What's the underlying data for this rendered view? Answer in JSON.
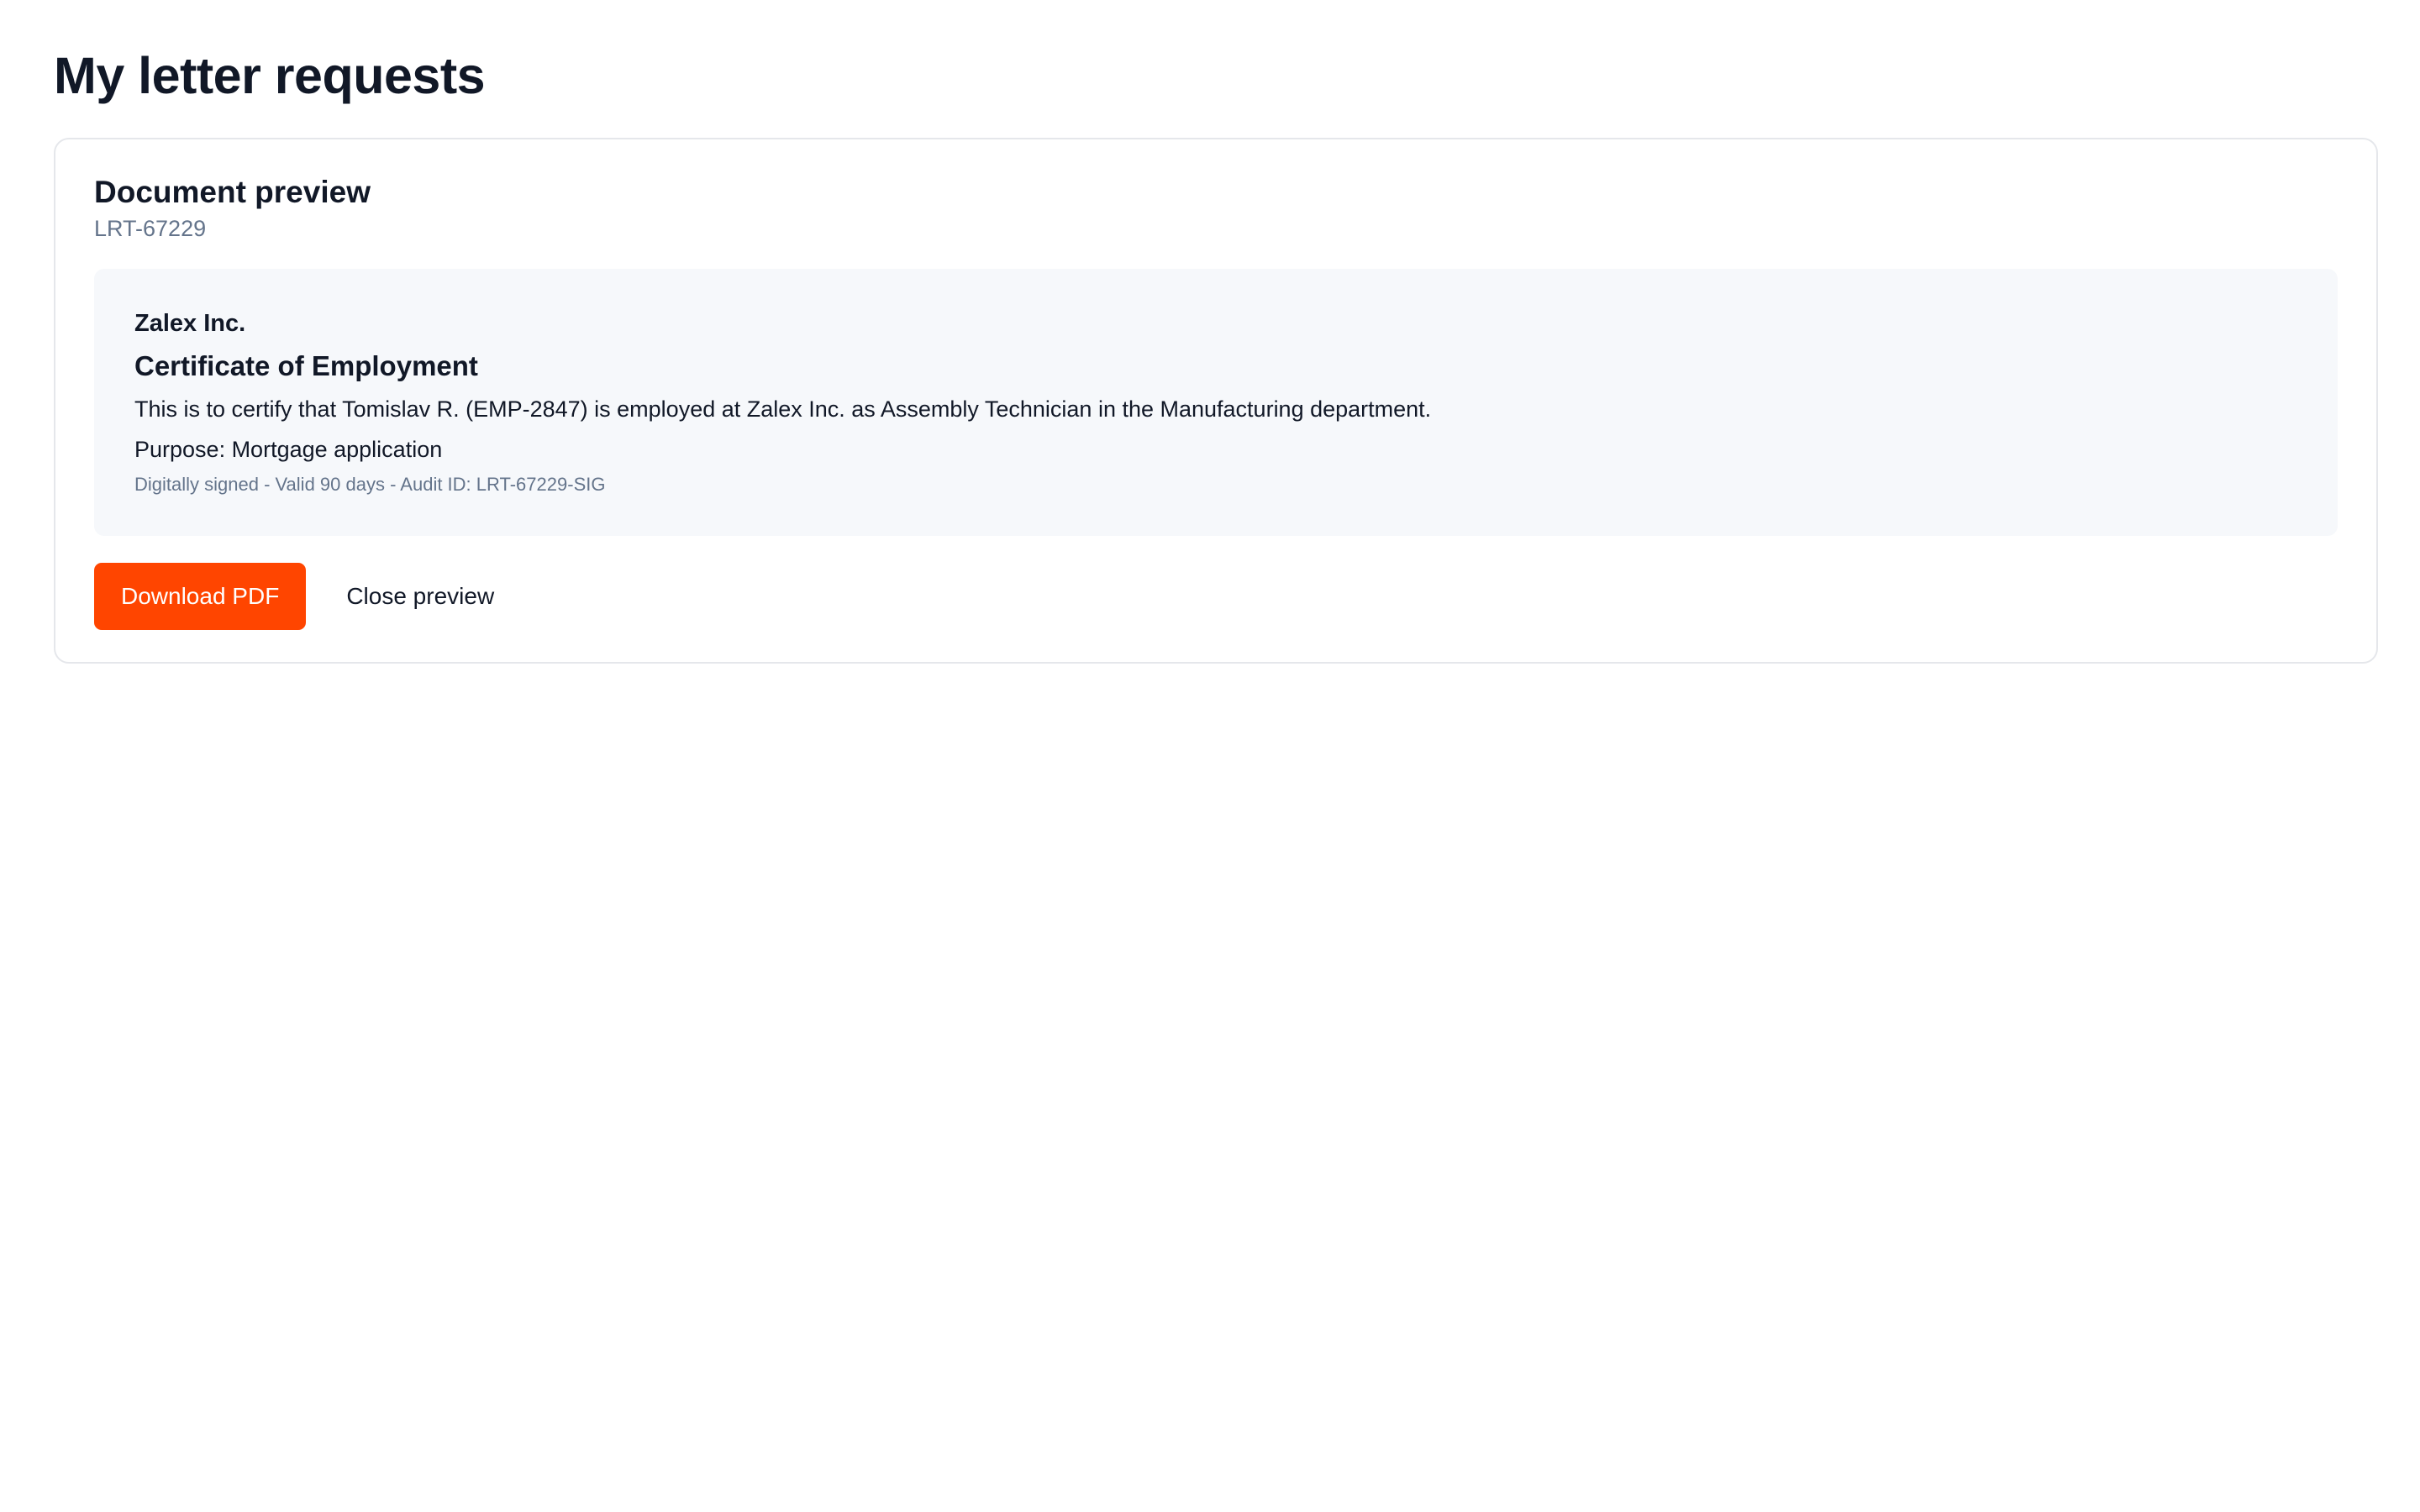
{
  "page": {
    "title": "My letter requests"
  },
  "preview": {
    "title": "Document preview",
    "reference": "LRT-67229",
    "document": {
      "company": "Zalex Inc.",
      "title": "Certificate of Employment",
      "body": "This is to certify that Tomislav R. (EMP-2847) is employed at Zalex Inc. as Assembly Technician in the Manufacturing department.",
      "purpose": "Purpose: Mortgage application",
      "footnote": "Digitally signed - Valid 90 days - Audit ID: LRT-67229-SIG"
    },
    "actions": {
      "download_label": "Download PDF",
      "close_label": "Close preview"
    }
  },
  "colors": {
    "accent": "#ff4500",
    "document_background": "#f6f8fb",
    "muted_text": "#64748b",
    "border": "#e5e7eb"
  }
}
